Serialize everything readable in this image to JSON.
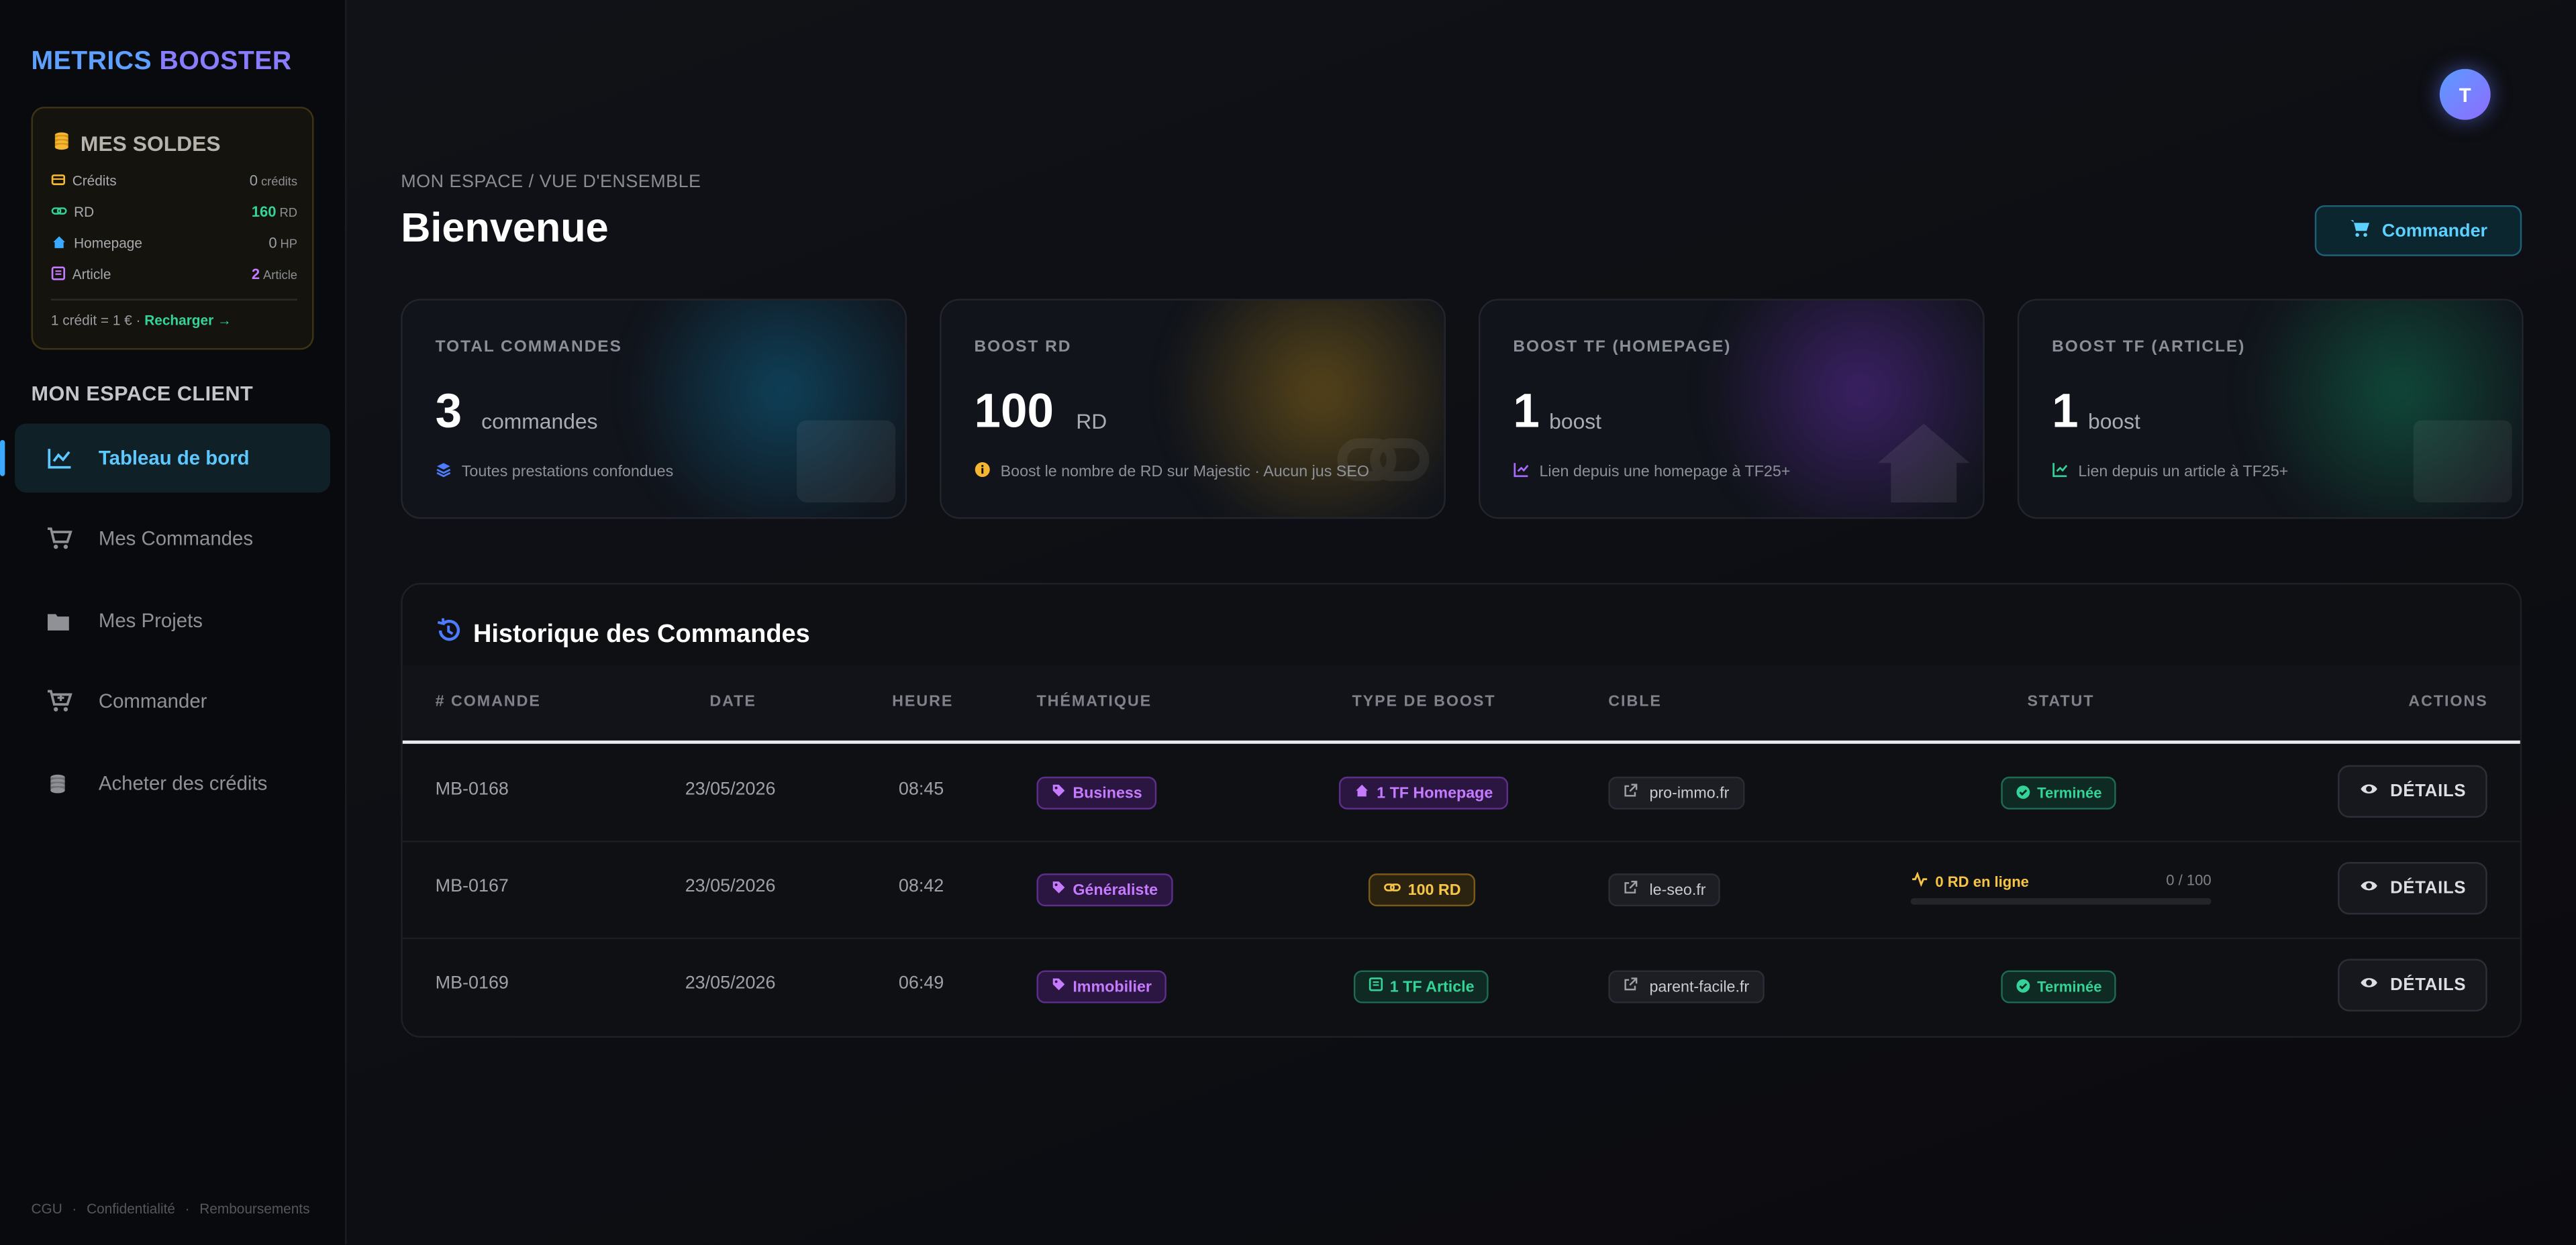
{
  "brand": {
    "part1": "METRICS ",
    "part2": "BOOSTER"
  },
  "balances": {
    "title": "MES SOLDES",
    "rows": [
      {
        "label": "Crédits",
        "value": "0",
        "unit": "crédits",
        "color": "#9ea1a8"
      },
      {
        "label": "RD",
        "value": "160",
        "unit": "RD",
        "color": "#34d399"
      },
      {
        "label": "Homepage",
        "value": "0",
        "unit": "HP",
        "color": "#9ea1a8"
      },
      {
        "label": "Article",
        "value": "2",
        "unit": "Article",
        "color": "#c67bff"
      }
    ],
    "rate": "1 crédit = 1 € · ",
    "recharge": "Recharger →"
  },
  "sidebar": {
    "section": "MON ESPACE CLIENT",
    "items": [
      {
        "label": "Tableau de bord",
        "icon": "chart-line-icon"
      },
      {
        "label": "Mes Commandes",
        "icon": "cart-icon"
      },
      {
        "label": "Mes Projets",
        "icon": "folder-icon"
      },
      {
        "label": "Commander",
        "icon": "cart-plus-icon"
      },
      {
        "label": "Acheter des crédits",
        "icon": "coins-icon"
      }
    ],
    "legal": [
      "CGU",
      "Confidentialité",
      "Remboursements"
    ]
  },
  "header": {
    "breadcrumb": "MON ESPACE / VUE D'ENSEMBLE",
    "title": "Bienvenue",
    "order_button": "Commander",
    "avatar_initial": "T"
  },
  "stats": [
    {
      "label": "TOTAL COMMANDES",
      "value": "3",
      "unit": "commandes",
      "desc": "Toutes prestations confondues",
      "accent": "#0e4e6b"
    },
    {
      "label": "BOOST RD",
      "value": "100",
      "unit": "RD",
      "desc": "Boost le nombre de RD sur Majestic · Aucun jus SEO",
      "accent": "#5e4a18"
    },
    {
      "label": "BOOST TF (HOMEPAGE)",
      "value": "1",
      "unit": "boost",
      "desc": "Lien depuis une homepage à TF25+",
      "accent": "#3b1e63"
    },
    {
      "label": "BOOST TF (ARTICLE)",
      "value": "1",
      "unit": "boost",
      "desc": "Lien depuis un article à TF25+",
      "accent": "#0e4a3a"
    }
  ],
  "history": {
    "title": "Historique des Commandes",
    "columns": [
      "# COMANDE",
      "DATE",
      "HEURE",
      "THÉMATIQUE",
      "TYPE DE BOOST",
      "CIBLE",
      "STATUT",
      "ACTIONS"
    ],
    "rows": [
      {
        "id": "MB-0168",
        "date": "23/05/2026",
        "time": "08:45",
        "theme": "Business",
        "boost": "1 TF Homepage",
        "boost_kind": "purple",
        "target": "pro-immo.fr",
        "status": "Terminée",
        "action": "DÉTAILS"
      },
      {
        "id": "MB-0167",
        "date": "23/05/2026",
        "time": "08:42",
        "theme": "Généraliste",
        "boost": "100 RD",
        "boost_kind": "yellow",
        "target": "le-seo.fr",
        "progress_label": "0 RD en ligne",
        "progress_count": "0 / 100",
        "progress": 0,
        "action": "DÉTAILS"
      },
      {
        "id": "MB-0169",
        "date": "23/05/2026",
        "time": "06:49",
        "theme": "Immobilier",
        "boost": "1 TF Article",
        "boost_kind": "green",
        "target": "parent-facile.fr",
        "status": "Terminée",
        "action": "DÉTAILS"
      }
    ]
  }
}
